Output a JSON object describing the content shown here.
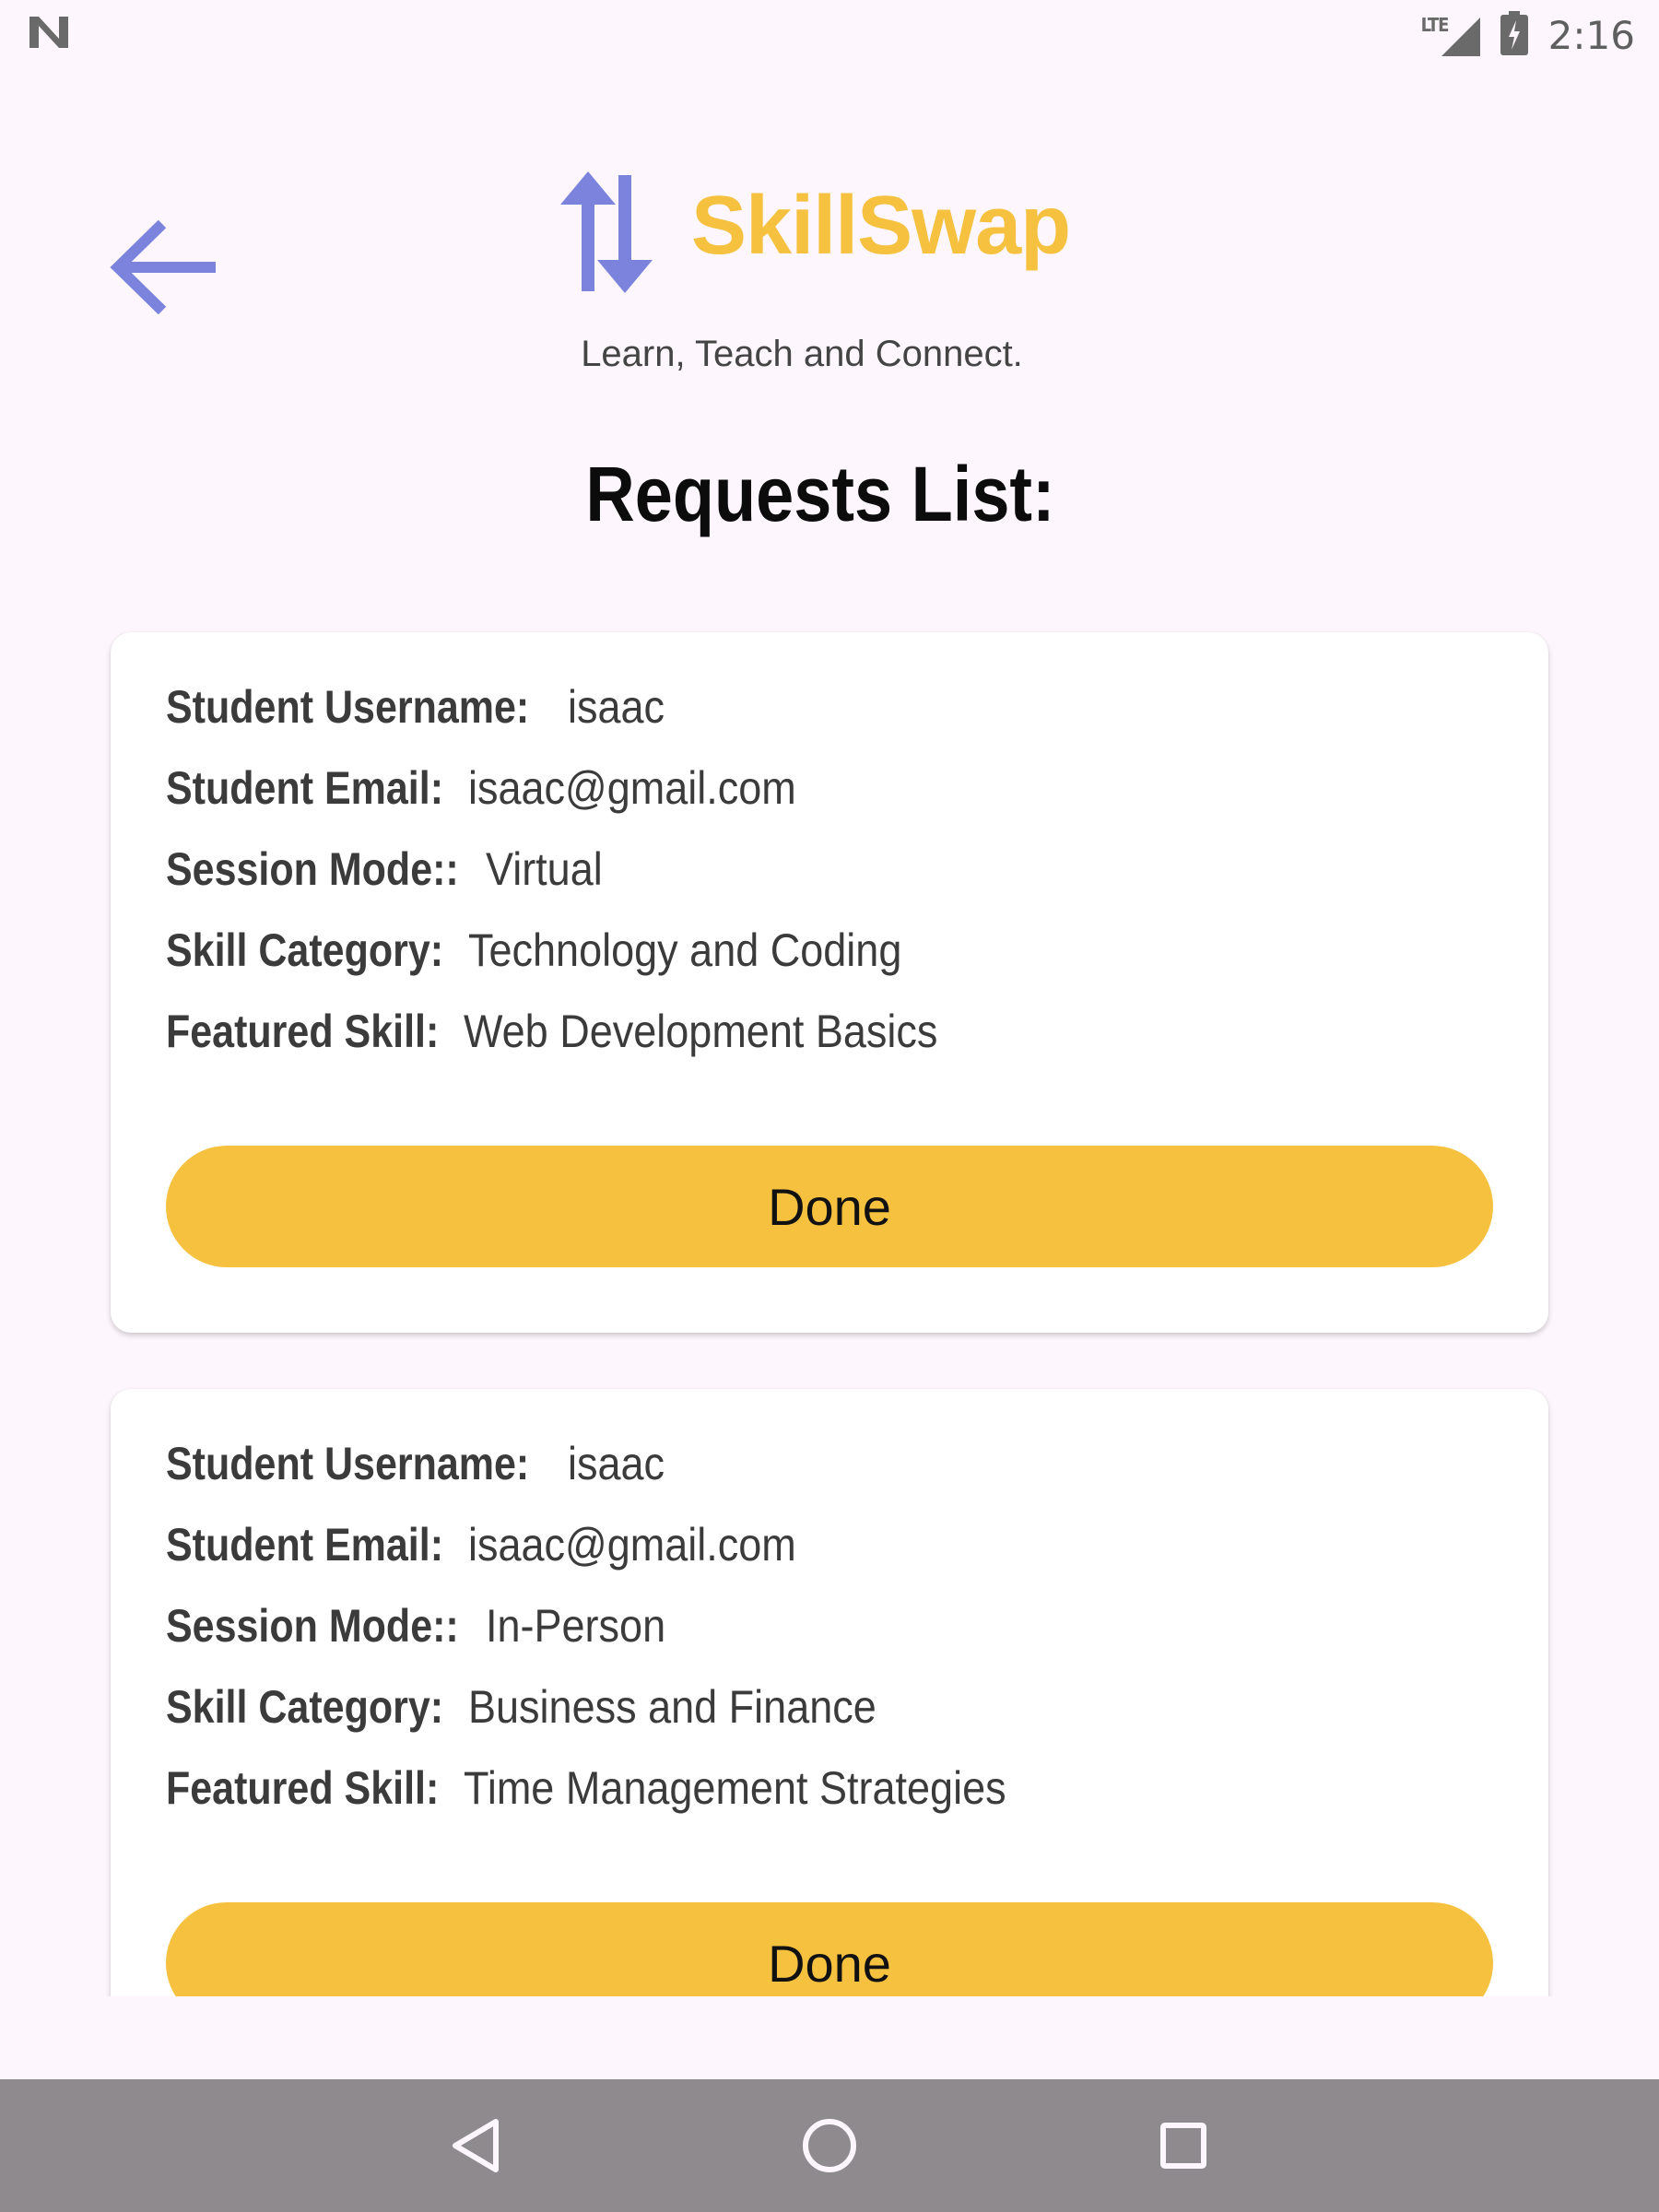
{
  "status_bar": {
    "network": "LTE",
    "time": "2:16"
  },
  "header": {
    "app_name": "SkillSwap",
    "tagline": "Learn, Teach and Connect.",
    "back_icon": "arrow-left-icon",
    "logo_icon": "swap-arrows-icon"
  },
  "page_title": "Requests List:",
  "labels": {
    "username": "Student Username:",
    "email": "Student Email:",
    "mode": "Session Mode::",
    "category": "Skill Category:",
    "skill": "Featured Skill:",
    "done": "Done"
  },
  "requests": [
    {
      "username": "isaac",
      "email": "isaac@gmail.com",
      "mode": "Virtual",
      "category": "Technology and Coding",
      "skill": "Web Development Basics"
    },
    {
      "username": "isaac",
      "email": "isaac@gmail.com",
      "mode": "In-Person",
      "category": "Business and Finance",
      "skill": "Time Management Strategies"
    }
  ],
  "colors": {
    "brand": "#f5c13f",
    "accent": "#7b83dd",
    "background": "#fdf6fc",
    "nav_bar": "#8e8a8e"
  },
  "nav_bar": {
    "icons": [
      "back-triangle-icon",
      "home-circle-icon",
      "recents-square-icon"
    ]
  }
}
